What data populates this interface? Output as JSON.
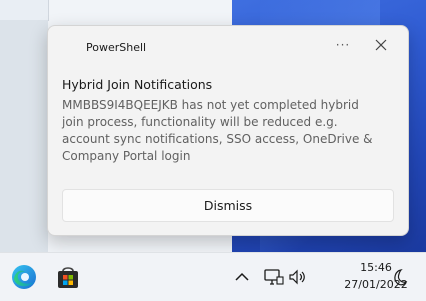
{
  "notification": {
    "app_name": "PowerShell",
    "more_label": "···",
    "title": "Hybrid Join Notifications",
    "body": "MMBBS9I4BQEEJKB has not yet completed hybrid join process, functionality will be reduced e.g. account sync notifications, SSO access, OneDrive & Company Portal login",
    "dismiss_label": "Dismiss"
  },
  "taskbar": {
    "time": "15:46",
    "date": "27/01/2022",
    "icons": [
      "edge-icon",
      "store-icon",
      "chevron-up-icon",
      "network-icon",
      "volume-icon",
      "focus-moon-icon"
    ]
  },
  "colors": {
    "accent_blue": "#2f5bd2",
    "toast_bg": "#f3f3f3",
    "taskbar_bg": "#f1f3f7"
  }
}
